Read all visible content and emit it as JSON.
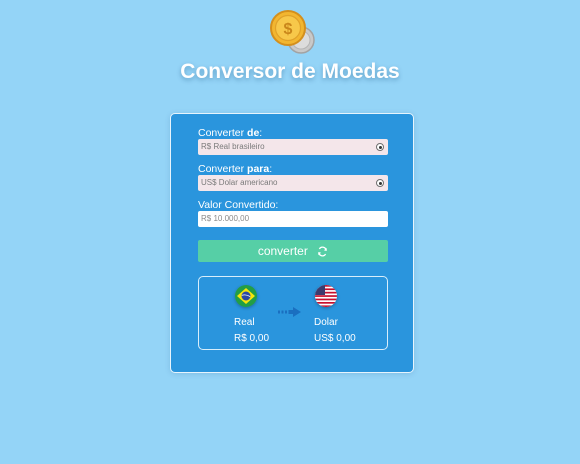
{
  "app": {
    "title": "Conversor de Moedas",
    "logo_icon": "coins-icon",
    "coin_label": "$"
  },
  "form": {
    "from": {
      "label_prefix": "Converter ",
      "label_bold": "de",
      "label_suffix": ":",
      "value": "R$ Real brasileiro"
    },
    "to": {
      "label_prefix": "Converter ",
      "label_bold": "para",
      "label_suffix": ":",
      "value": "US$ Dolar americano"
    },
    "amount": {
      "label": "Valor Convertido:",
      "placeholder": "R$ 10.000,00"
    },
    "convert_button": {
      "label": "converter",
      "icon": "refresh-icon"
    }
  },
  "result": {
    "from": {
      "flag": "brazil-flag-icon",
      "name": "Real",
      "value": "R$ 0,00"
    },
    "arrow_icon": "arrow-right-icon",
    "to": {
      "flag": "usa-flag-icon",
      "name": "Dolar",
      "value": "US$ 0,00"
    }
  },
  "colors": {
    "background": "#94d4f7",
    "card": "#2a95dd",
    "button": "#56cfa6",
    "select_bg": "#f4e6ea"
  }
}
